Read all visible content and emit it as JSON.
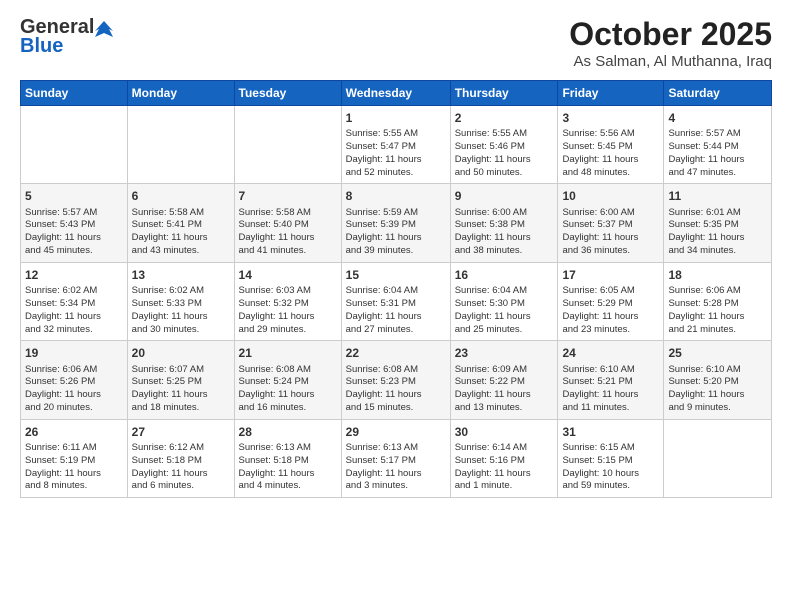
{
  "header": {
    "logo_general": "General",
    "logo_blue": "Blue",
    "month_title": "October 2025",
    "location": "As Salman, Al Muthanna, Iraq"
  },
  "weekdays": [
    "Sunday",
    "Monday",
    "Tuesday",
    "Wednesday",
    "Thursday",
    "Friday",
    "Saturday"
  ],
  "weeks": [
    [
      {
        "day": "",
        "info": ""
      },
      {
        "day": "",
        "info": ""
      },
      {
        "day": "",
        "info": ""
      },
      {
        "day": "1",
        "info": "Sunrise: 5:55 AM\nSunset: 5:47 PM\nDaylight: 11 hours\nand 52 minutes."
      },
      {
        "day": "2",
        "info": "Sunrise: 5:55 AM\nSunset: 5:46 PM\nDaylight: 11 hours\nand 50 minutes."
      },
      {
        "day": "3",
        "info": "Sunrise: 5:56 AM\nSunset: 5:45 PM\nDaylight: 11 hours\nand 48 minutes."
      },
      {
        "day": "4",
        "info": "Sunrise: 5:57 AM\nSunset: 5:44 PM\nDaylight: 11 hours\nand 47 minutes."
      }
    ],
    [
      {
        "day": "5",
        "info": "Sunrise: 5:57 AM\nSunset: 5:43 PM\nDaylight: 11 hours\nand 45 minutes."
      },
      {
        "day": "6",
        "info": "Sunrise: 5:58 AM\nSunset: 5:41 PM\nDaylight: 11 hours\nand 43 minutes."
      },
      {
        "day": "7",
        "info": "Sunrise: 5:58 AM\nSunset: 5:40 PM\nDaylight: 11 hours\nand 41 minutes."
      },
      {
        "day": "8",
        "info": "Sunrise: 5:59 AM\nSunset: 5:39 PM\nDaylight: 11 hours\nand 39 minutes."
      },
      {
        "day": "9",
        "info": "Sunrise: 6:00 AM\nSunset: 5:38 PM\nDaylight: 11 hours\nand 38 minutes."
      },
      {
        "day": "10",
        "info": "Sunrise: 6:00 AM\nSunset: 5:37 PM\nDaylight: 11 hours\nand 36 minutes."
      },
      {
        "day": "11",
        "info": "Sunrise: 6:01 AM\nSunset: 5:35 PM\nDaylight: 11 hours\nand 34 minutes."
      }
    ],
    [
      {
        "day": "12",
        "info": "Sunrise: 6:02 AM\nSunset: 5:34 PM\nDaylight: 11 hours\nand 32 minutes."
      },
      {
        "day": "13",
        "info": "Sunrise: 6:02 AM\nSunset: 5:33 PM\nDaylight: 11 hours\nand 30 minutes."
      },
      {
        "day": "14",
        "info": "Sunrise: 6:03 AM\nSunset: 5:32 PM\nDaylight: 11 hours\nand 29 minutes."
      },
      {
        "day": "15",
        "info": "Sunrise: 6:04 AM\nSunset: 5:31 PM\nDaylight: 11 hours\nand 27 minutes."
      },
      {
        "day": "16",
        "info": "Sunrise: 6:04 AM\nSunset: 5:30 PM\nDaylight: 11 hours\nand 25 minutes."
      },
      {
        "day": "17",
        "info": "Sunrise: 6:05 AM\nSunset: 5:29 PM\nDaylight: 11 hours\nand 23 minutes."
      },
      {
        "day": "18",
        "info": "Sunrise: 6:06 AM\nSunset: 5:28 PM\nDaylight: 11 hours\nand 21 minutes."
      }
    ],
    [
      {
        "day": "19",
        "info": "Sunrise: 6:06 AM\nSunset: 5:26 PM\nDaylight: 11 hours\nand 20 minutes."
      },
      {
        "day": "20",
        "info": "Sunrise: 6:07 AM\nSunset: 5:25 PM\nDaylight: 11 hours\nand 18 minutes."
      },
      {
        "day": "21",
        "info": "Sunrise: 6:08 AM\nSunset: 5:24 PM\nDaylight: 11 hours\nand 16 minutes."
      },
      {
        "day": "22",
        "info": "Sunrise: 6:08 AM\nSunset: 5:23 PM\nDaylight: 11 hours\nand 15 minutes."
      },
      {
        "day": "23",
        "info": "Sunrise: 6:09 AM\nSunset: 5:22 PM\nDaylight: 11 hours\nand 13 minutes."
      },
      {
        "day": "24",
        "info": "Sunrise: 6:10 AM\nSunset: 5:21 PM\nDaylight: 11 hours\nand 11 minutes."
      },
      {
        "day": "25",
        "info": "Sunrise: 6:10 AM\nSunset: 5:20 PM\nDaylight: 11 hours\nand 9 minutes."
      }
    ],
    [
      {
        "day": "26",
        "info": "Sunrise: 6:11 AM\nSunset: 5:19 PM\nDaylight: 11 hours\nand 8 minutes."
      },
      {
        "day": "27",
        "info": "Sunrise: 6:12 AM\nSunset: 5:18 PM\nDaylight: 11 hours\nand 6 minutes."
      },
      {
        "day": "28",
        "info": "Sunrise: 6:13 AM\nSunset: 5:18 PM\nDaylight: 11 hours\nand 4 minutes."
      },
      {
        "day": "29",
        "info": "Sunrise: 6:13 AM\nSunset: 5:17 PM\nDaylight: 11 hours\nand 3 minutes."
      },
      {
        "day": "30",
        "info": "Sunrise: 6:14 AM\nSunset: 5:16 PM\nDaylight: 11 hours\nand 1 minute."
      },
      {
        "day": "31",
        "info": "Sunrise: 6:15 AM\nSunset: 5:15 PM\nDaylight: 10 hours\nand 59 minutes."
      },
      {
        "day": "",
        "info": ""
      }
    ]
  ]
}
